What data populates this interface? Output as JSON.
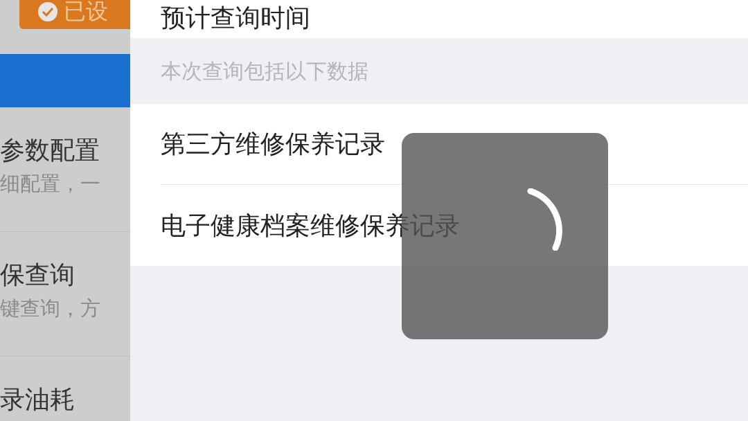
{
  "left_panel": {
    "badge": {
      "label": "已设"
    },
    "items": [
      {
        "title": "参数配置",
        "subtitle": "细配置，一"
      },
      {
        "title": "保查询",
        "subtitle": "键查询，方"
      },
      {
        "title": "录油耗"
      }
    ]
  },
  "drawer": {
    "top_row": "预计查询时间",
    "section_header": "本次查询包括以下数据",
    "records": [
      "第三方维修保养记录",
      "电子健康档案维修保养记录"
    ]
  }
}
